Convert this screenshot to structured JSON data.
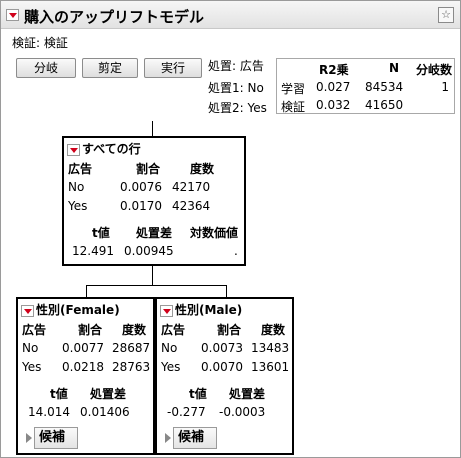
{
  "window": {
    "title": "購入のアップリフトモデル"
  },
  "validation_label": "検証: 検証",
  "buttons": {
    "split": "分岐",
    "prune": "剪定",
    "go": "実行"
  },
  "treatment_info": {
    "treatment": "処置: 広告",
    "treatment1": "処置1: No",
    "treatment2": "処置2: Yes"
  },
  "fit_stats": {
    "headers": [
      "R2乗",
      "N",
      "分岐数"
    ],
    "rows": [
      {
        "label": "学習",
        "r2": "0.027",
        "n": "84534",
        "splits": "1"
      },
      {
        "label": "検証",
        "r2": "0.032",
        "n": "41650",
        "splits": ""
      }
    ]
  },
  "nodes": {
    "root": {
      "title": "すべての行",
      "col_headers": [
        "広告",
        "割合",
        "度数"
      ],
      "rows": [
        {
          "level": "No",
          "rate": "0.0076",
          "count": "42170"
        },
        {
          "level": "Yes",
          "rate": "0.0170",
          "count": "42364"
        }
      ],
      "test_headers": [
        "t値",
        "処置差",
        "対数価値"
      ],
      "test_values": [
        "12.491",
        "0.00945",
        "."
      ]
    },
    "female": {
      "title": "性別(Female)",
      "col_headers": [
        "広告",
        "割合",
        "度数"
      ],
      "rows": [
        {
          "level": "No",
          "rate": "0.0077",
          "count": "28687"
        },
        {
          "level": "Yes",
          "rate": "0.0218",
          "count": "28763"
        }
      ],
      "test_headers": [
        "t値",
        "処置差"
      ],
      "test_values": [
        "14.014",
        "0.01406"
      ],
      "candidates": "候補"
    },
    "male": {
      "title": "性別(Male)",
      "col_headers": [
        "広告",
        "割合",
        "度数"
      ],
      "rows": [
        {
          "level": "No",
          "rate": "0.0073",
          "count": "13483"
        },
        {
          "level": "Yes",
          "rate": "0.0070",
          "count": "13601"
        }
      ],
      "test_headers": [
        "t値",
        "処置差"
      ],
      "test_values": [
        "-0.277",
        "-0.0003"
      ],
      "candidates": "候補"
    }
  },
  "icons": {
    "menu": "red-triangle-icon",
    "star": "star-icon",
    "disclosure": "disclosure-triangle-icon"
  },
  "colors": {
    "menu_triangle": "#d0021b"
  }
}
